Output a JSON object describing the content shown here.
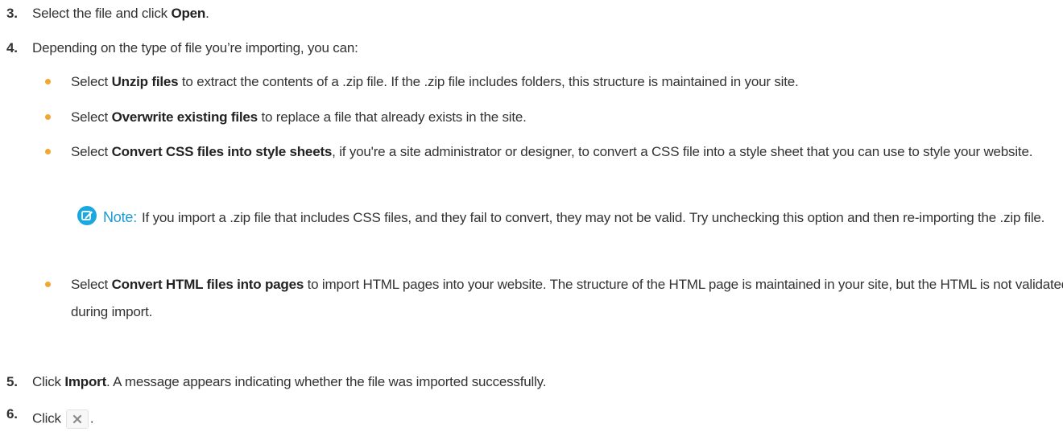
{
  "steps": {
    "s3": {
      "num": "3.",
      "pre": "Select the file and click ",
      "bold": "Open",
      "post": "."
    },
    "s4": {
      "num": "4.",
      "text": "Depending on the type of file you’re importing, you can:"
    },
    "s5": {
      "num": "5.",
      "pre": "Click ",
      "bold": "Import",
      "post": ". A message appears indicating whether the file was imported successfully."
    },
    "s6": {
      "num": "6.",
      "pre": "Click",
      "post": ".",
      "icon": "close-icon"
    }
  },
  "bullets": {
    "b1": {
      "pre": "Select ",
      "bold": "Unzip files",
      "post": " to extract the contents of a .zip file. If the .zip file includes folders, this structure is maintained in your site."
    },
    "b2": {
      "pre": "Select ",
      "bold": "Overwrite existing files",
      "post": " to replace a file that already exists in the site."
    },
    "b3": {
      "pre": "Select ",
      "bold": "Convert CSS files into style sheets",
      "post": ", if you're a site administrator or designer, to convert a CSS file into a style sheet that you can use to style your website."
    },
    "b4": {
      "pre": "Select ",
      "bold": "Convert HTML files into pages",
      "post": " to import HTML pages into your website. The structure of the HTML page is maintained in your site, but the HTML is not validated during import."
    }
  },
  "note": {
    "label": "Note:",
    "text": "If you import a .zip file that includes CSS files, and they fail to convert, they may not be valid. Try unchecking this option and then re-importing the .zip file.",
    "icon": "edit-note-icon"
  },
  "colors": {
    "bullet": "#f0a830",
    "note_accent": "#1ba7e0",
    "text": "#333333"
  }
}
